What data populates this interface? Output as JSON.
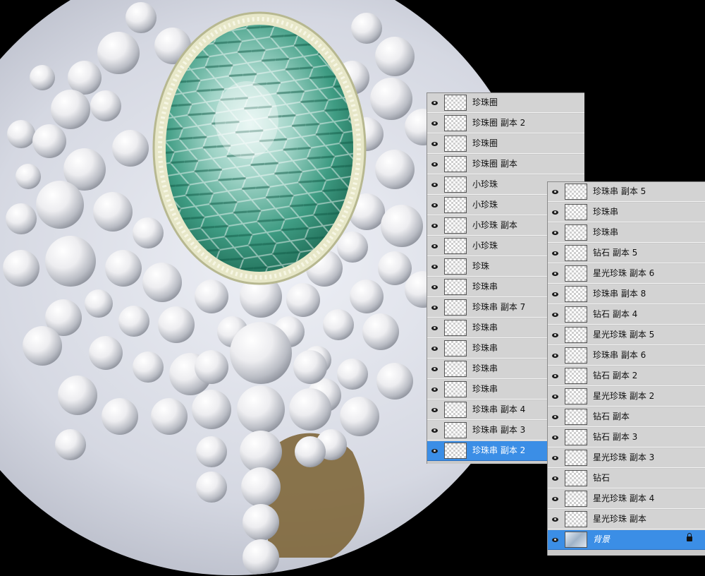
{
  "panel_a": {
    "layers": [
      {
        "name": "珍珠圈"
      },
      {
        "name": "珍珠圈 副本 2"
      },
      {
        "name": "珍珠圈"
      },
      {
        "name": "珍珠圈 副本"
      },
      {
        "name": "小珍珠"
      },
      {
        "name": "小珍珠"
      },
      {
        "name": "小珍珠 副本"
      },
      {
        "name": "小珍珠"
      },
      {
        "name": "珍珠"
      },
      {
        "name": "珍珠串"
      },
      {
        "name": "珍珠串 副本 7"
      },
      {
        "name": "珍珠串"
      },
      {
        "name": "珍珠串"
      },
      {
        "name": "珍珠串"
      },
      {
        "name": "珍珠串"
      },
      {
        "name": "珍珠串 副本 4"
      },
      {
        "name": "珍珠串 副本 3"
      },
      {
        "name": "珍珠串 副本 2",
        "selected": true
      }
    ]
  },
  "panel_b": {
    "layers": [
      {
        "name": "珍珠串 副本 5"
      },
      {
        "name": "珍珠串"
      },
      {
        "name": "珍珠串"
      },
      {
        "name": "钻石 副本 5"
      },
      {
        "name": "星光珍珠 副本 6"
      },
      {
        "name": "珍珠串 副本 8"
      },
      {
        "name": "钻石 副本 4"
      },
      {
        "name": "星光珍珠 副本 5"
      },
      {
        "name": "珍珠串 副本 6"
      },
      {
        "name": "钻石 副本 2"
      },
      {
        "name": "星光珍珠 副本 2"
      },
      {
        "name": "钻石 副本"
      },
      {
        "name": "钻石 副本 3"
      },
      {
        "name": "星光珍珠 副本 3"
      },
      {
        "name": "钻石"
      },
      {
        "name": "星光珍珠 副本 4"
      },
      {
        "name": "星光珍珠 副本"
      },
      {
        "name": "背景",
        "selected": true,
        "background": true,
        "locked": true
      }
    ]
  },
  "icons": {
    "visibility": "eye-icon",
    "lock": "lock-icon"
  },
  "colors": {
    "selection": "#3b8ee6",
    "panel_bg": "#d3d3d3",
    "canvas_bg": "#000000"
  }
}
